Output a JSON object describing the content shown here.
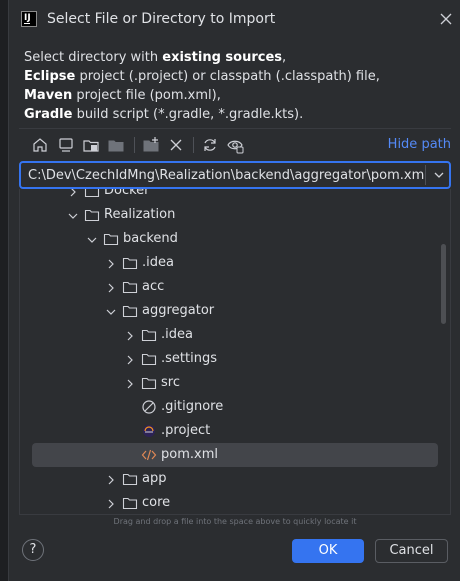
{
  "dialog": {
    "title": "Select File or Directory to Import",
    "app_icon_text": "IJ"
  },
  "description": {
    "line1_prefix": "Select directory with ",
    "line1_bold": "existing sources",
    "line1_suffix": ",",
    "line2_bold": "Eclipse",
    "line2_suffix": " project (.project) or classpath (.classpath) file,",
    "line3_bold": "Maven",
    "line3_suffix": " project file (pom.xml),",
    "line4_bold": "Gradle",
    "line4_suffix": " build script (*.gradle, *.gradle.kts)."
  },
  "toolbar": {
    "hide_path_label": "Hide path",
    "icons": [
      "home-icon",
      "desktop-icon",
      "project-folder-icon",
      "module-folder-icon",
      "new-folder-icon",
      "delete-icon",
      "refresh-icon",
      "show-hidden-icon"
    ]
  },
  "path": {
    "value": "C:\\Dev\\CzechIdMng\\Realization\\backend\\aggregator\\pom.xml"
  },
  "tree": {
    "rows": [
      {
        "label": "Docker",
        "type": "folder",
        "expanded": false,
        "level": 0
      },
      {
        "label": "Realization",
        "type": "folder",
        "expanded": true,
        "level": 0
      },
      {
        "label": "backend",
        "type": "folder",
        "expanded": true,
        "level": 1
      },
      {
        "label": ".idea",
        "type": "folder",
        "expanded": false,
        "level": 2
      },
      {
        "label": "acc",
        "type": "folder",
        "expanded": false,
        "level": 2
      },
      {
        "label": "aggregator",
        "type": "folder",
        "expanded": true,
        "level": 2
      },
      {
        "label": ".idea",
        "type": "folder",
        "expanded": false,
        "level": 3
      },
      {
        "label": ".settings",
        "type": "folder",
        "expanded": false,
        "level": 3
      },
      {
        "label": "src",
        "type": "folder",
        "expanded": false,
        "level": 3
      },
      {
        "label": ".gitignore",
        "type": "gitignore",
        "level": 3
      },
      {
        "label": ".project",
        "type": "eclipse",
        "level": 3
      },
      {
        "label": "pom.xml",
        "type": "xml",
        "level": 3,
        "selected": true
      },
      {
        "label": "app",
        "type": "folder",
        "expanded": false,
        "level": 2
      },
      {
        "label": "core",
        "type": "folder",
        "expanded": false,
        "level": 2
      }
    ]
  },
  "hint": "Drag and drop a file into the space above to quickly locate it",
  "buttons": {
    "help": "?",
    "ok": "OK",
    "cancel": "Cancel"
  },
  "colors": {
    "accent": "#3574f0",
    "link": "#548af7",
    "background": "#2b2d30",
    "selection": "#43454a"
  }
}
